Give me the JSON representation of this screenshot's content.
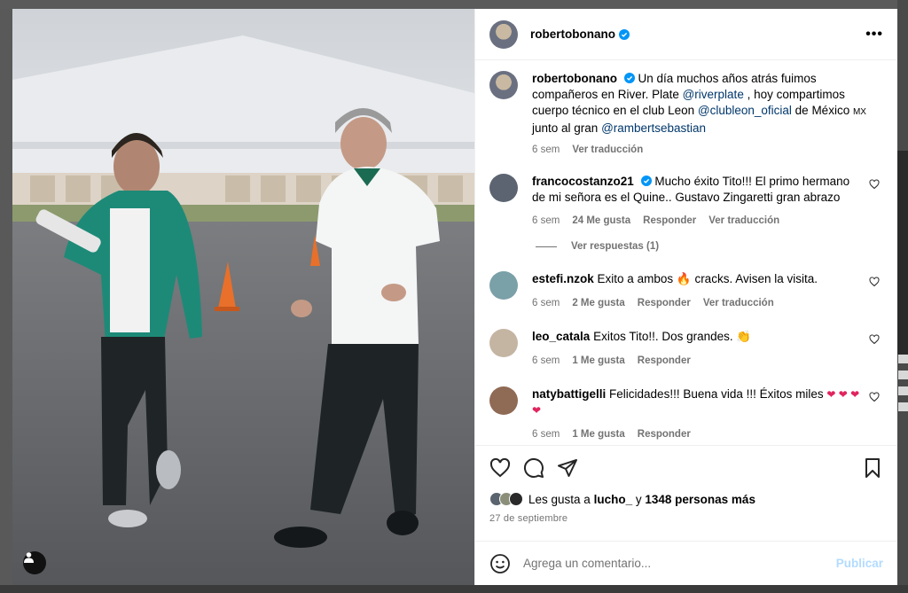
{
  "post": {
    "author": "robertobonano",
    "caption_parts": {
      "text1": "Un día muchos años atrás fuimos compañeros en River. Plate ",
      "mention1": "@riverplate",
      "text2": " , hoy compartimos cuerpo técnico en el club Leon ",
      "mention2": "@clubleon_oficial",
      "text3": " de México ",
      "flag": "MX",
      "text4": " junto al gran ",
      "mention3": "@rambertsebastian"
    },
    "caption_time": "6 sem",
    "caption_translate": "Ver traducción"
  },
  "comments": [
    {
      "user": "francocostanzo21",
      "verified": true,
      "text": "Mucho éxito Tito!!! El primo hermano de mi señora es el Quine.. Gustavo Zingaretti gran abrazo",
      "time": "6 sem",
      "likes": "24 Me gusta",
      "reply": "Responder",
      "translate": "Ver traducción",
      "replies_label": "Ver respuestas (1)"
    },
    {
      "user": "estefi.nzok",
      "text_a": "Exito a ambos",
      "emoji": "🔥",
      "text_b": "cracks. Avisen la visita.",
      "time": "6 sem",
      "likes": "2 Me gusta",
      "reply": "Responder",
      "translate": "Ver traducción"
    },
    {
      "user": "leo_catala",
      "text": "Exitos Tito!!. Dos grandes.",
      "emoji": "👏",
      "time": "6 sem",
      "likes": "1 Me gusta",
      "reply": "Responder"
    },
    {
      "user": "natybattigelli",
      "text": "Felicidades!!! Buena vida !!! Éxitos miles",
      "hearts": "❤ ❤ ❤ ❤",
      "time": "6 sem",
      "likes": "1 Me gusta",
      "reply": "Responder"
    }
  ],
  "likes": {
    "prefix": "Les gusta a",
    "first_user": "lucho_",
    "connector": "y",
    "others": "1348 personas más"
  },
  "date": "27 de septiembre",
  "add_comment": {
    "placeholder": "Agrega un comentario...",
    "publish": "Publicar"
  },
  "colors": {
    "verified": "#0095f6",
    "link": "#00376b",
    "muted": "#737373",
    "publish_disabled": "#b3dbff"
  },
  "icons": [
    "more-options-icon",
    "heart-icon",
    "comment-icon",
    "share-icon",
    "save-icon",
    "emoji-icon",
    "user-tag-icon",
    "verified-badge-icon"
  ]
}
